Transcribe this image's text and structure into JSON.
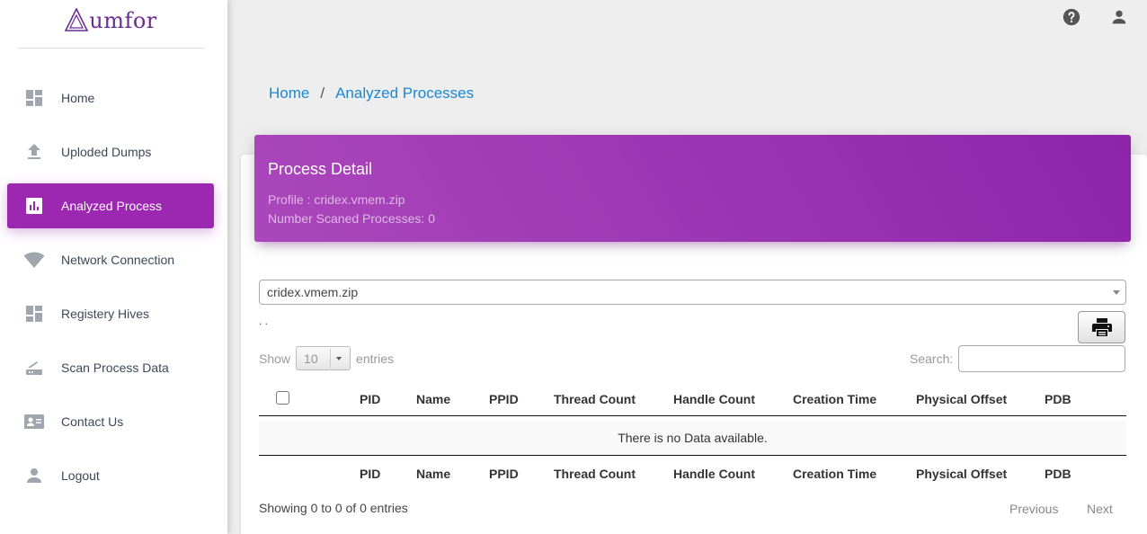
{
  "brand": {
    "name": "umfor",
    "logo_icon": "triangle-a-logo"
  },
  "accent_color": "#9c27b0",
  "sidebar": {
    "items": [
      {
        "label": "Home",
        "icon": "dashboard-icon",
        "active": false
      },
      {
        "label": "Uploded Dumps",
        "icon": "upload-icon",
        "active": false
      },
      {
        "label": "Analyzed Process",
        "icon": "bar-chart-icon",
        "active": true
      },
      {
        "label": "Network Connection",
        "icon": "wifi-icon",
        "active": false
      },
      {
        "label": "Registery Hives",
        "icon": "dashboard-icon",
        "active": false
      },
      {
        "label": "Scan Process Data",
        "icon": "router-icon",
        "active": false
      },
      {
        "label": "Contact Us",
        "icon": "contact-card-icon",
        "active": false
      },
      {
        "label": "Logout",
        "icon": "person-icon",
        "active": false
      }
    ]
  },
  "topbar": {
    "help_icon": "help-icon",
    "user_icon": "person-icon"
  },
  "breadcrumb": {
    "home": "Home",
    "separator": "/",
    "current": "Analyzed Processes"
  },
  "card": {
    "title": "Process Detail",
    "profile": "Profile : cridex.vmem.zip",
    "scanned": "Number Scaned Processes: 0"
  },
  "dump_select": {
    "value": "cridex.vmem.zip"
  },
  "dots": ". .",
  "print_icon": "print-icon",
  "table_controls": {
    "show_label": "Show",
    "length_value": "10",
    "entries_label": "entries",
    "search_label": "Search:",
    "search_value": ""
  },
  "table": {
    "columns": [
      "PID",
      "Name",
      "PPID",
      "Thread Count",
      "Handle Count",
      "Creation Time",
      "Physical Offset",
      "PDB"
    ],
    "empty_message": "There is no Data available."
  },
  "footer": {
    "info": "Showing 0 to 0 of 0 entries",
    "previous": "Previous",
    "next": "Next"
  }
}
